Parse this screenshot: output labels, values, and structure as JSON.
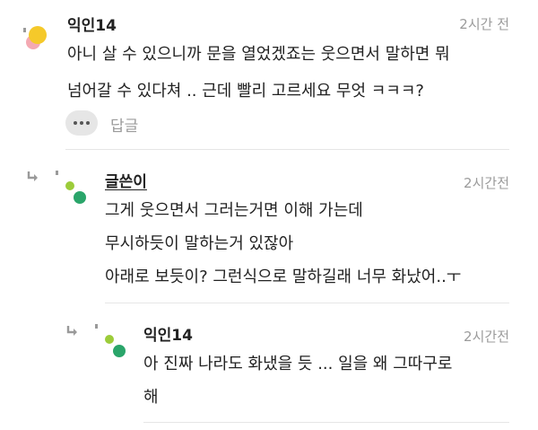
{
  "comments": [
    {
      "author": "익인14",
      "time": "2시간 전",
      "lines": [
        "아니 살 수 있으니까 문을 열었겠죠는 웃으면서 말하면 뭐",
        "넘어갈 수 있다쳐 .. 근데 빨리 고르세요 무엇 ㅋㅋㅋ?"
      ],
      "reply_label": "답글"
    },
    {
      "author": "글쓴이",
      "time": "2시간전",
      "lines": [
        "그게 웃으면서 그러는거면 이해 가는데",
        "무시하듯이 말하는거 있잖아",
        "아래로 보듯이? 그런식으로 말하길래 너무 화났어..ㅜ"
      ]
    },
    {
      "author": "익인14",
      "time": "2시간전",
      "lines": [
        "아 진짜 나라도 화냈을 듯 ... 일을 왜 그따구로",
        "해"
      ]
    }
  ],
  "colors": {
    "avatar_yellow": "#f5c92a",
    "avatar_pink": "#f4a9b2",
    "dot_lime": "#9ccc3a",
    "dot_green": "#2aa56a"
  }
}
